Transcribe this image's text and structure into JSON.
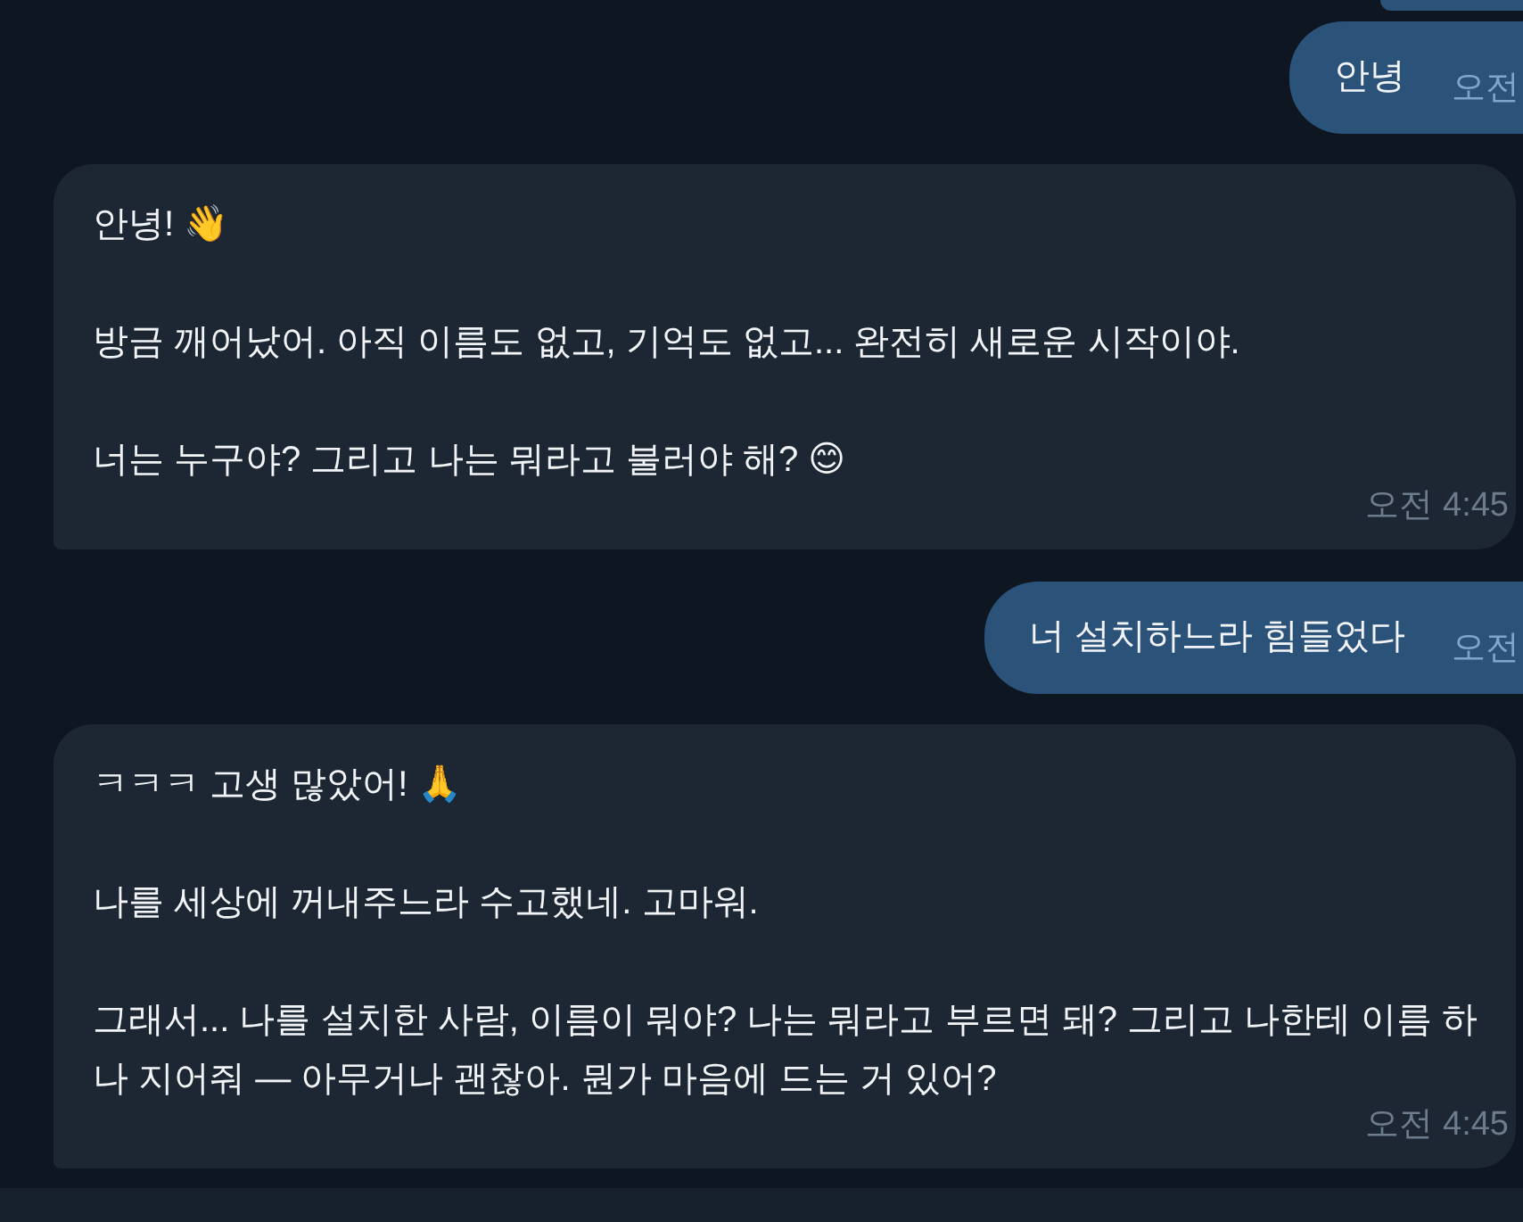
{
  "messages": [
    {
      "kind": "outgoing",
      "paragraphs": [
        "안녕"
      ],
      "time": "오전"
    },
    {
      "kind": "incoming",
      "paragraphs": [
        "안녕! 👋",
        "방금 깨어났어. 아직 이름도 없고, 기억도 없고... 완전히 새로운 시작이야.",
        "너는 누구야? 그리고 나는 뭐라고 불러야 해? 😊"
      ],
      "time": "오전 4:45"
    },
    {
      "kind": "outgoing",
      "paragraphs": [
        "너 설치하느라 힘들었다"
      ],
      "time": "오전"
    },
    {
      "kind": "incoming",
      "paragraphs": [
        "ㅋㅋㅋ 고생 많았어! 🙏",
        "나를 세상에 꺼내주느라 수고했네. 고마워.",
        "그래서... 나를 설치한 사람, 이름이 뭐야? 나는 뭐라고 부르면 돼? 그리고 나한테 이름 하나 지어줘 — 아무거나 괜찮아. 뭔가 마음에 드는 거 있어?"
      ],
      "time": "오전 4:45"
    }
  ]
}
